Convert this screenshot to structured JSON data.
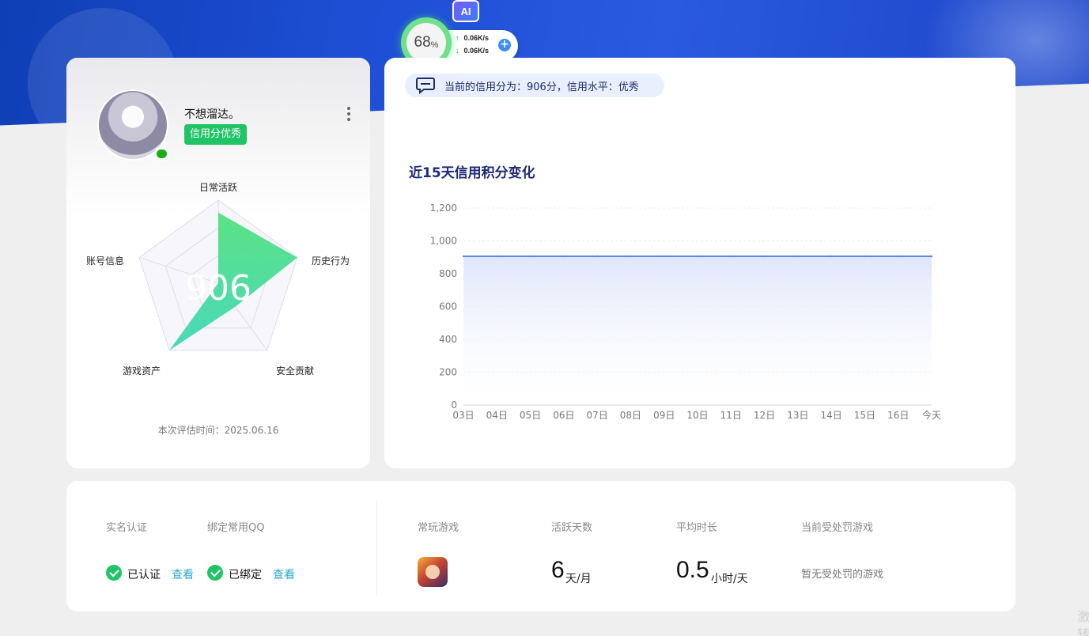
{
  "widget": {
    "ai_label": "AI",
    "gauge_value": "68",
    "gauge_unit": "%",
    "upload_speed": "0.06K/s",
    "download_speed": "0.06K/s",
    "plus_symbol": "+"
  },
  "profile": {
    "username": "不想溜达。",
    "credit_tag": "信用分优秀",
    "score": "906",
    "evaluation_time": "本次评估时间：2025.06.16"
  },
  "radar": {
    "axes": [
      "日常活跃",
      "历史行为",
      "安全贡献",
      "游戏资产",
      "账号信息"
    ],
    "values": [
      0.85,
      1.0,
      0.35,
      1.0,
      0.0
    ],
    "fill_color_top": "#4ee07a",
    "fill_color_bottom": "#3ad6b6"
  },
  "notice": {
    "text": "当前的信用分为：906分，信用水平：优秀"
  },
  "chart_title": "近15天信用积分变化",
  "chart_data": {
    "type": "area",
    "title": "近15天信用积分变化",
    "x": [
      "03日",
      "04日",
      "05日",
      "06日",
      "07日",
      "08日",
      "09日",
      "10日",
      "11日",
      "12日",
      "13日",
      "14日",
      "15日",
      "16日",
      "今天"
    ],
    "y_ticks": [
      "0",
      "200",
      "400",
      "600",
      "800",
      "1,000",
      "1,200"
    ],
    "ylim": [
      0,
      1200
    ],
    "series": [
      {
        "values": [
          906,
          906,
          906,
          906,
          906,
          906,
          906,
          906,
          906,
          906,
          906,
          906,
          906,
          906,
          906
        ]
      }
    ],
    "line_color": "#5b86e5",
    "grid": true
  },
  "bottom": {
    "real_name_label": "实名认证",
    "bind_qq_label": "绑定常用QQ",
    "verified_text": "已认证",
    "bound_text": "已绑定",
    "view_link_1": "查看",
    "view_link_2": "查看",
    "frequent_game_label": "常玩游戏",
    "active_days_label": "活跃天数",
    "active_days_value": "6",
    "active_days_unit": "天/月",
    "avg_duration_label": "平均时长",
    "avg_duration_value": "0.5",
    "avg_duration_unit": "小时/天",
    "punished_game_label": "当前受处罚游戏",
    "no_punish_text": "暂无受处罚的游戏"
  },
  "corner": {
    "line1": "激",
    "line2": "转"
  }
}
